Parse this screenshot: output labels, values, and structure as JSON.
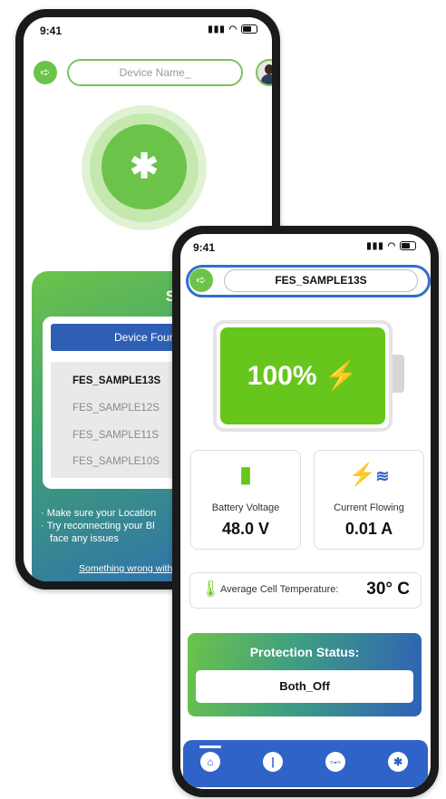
{
  "back_screen": {
    "status": {
      "time": "9:41"
    },
    "device_name_placeholder": "Device Name_",
    "scan_title": "Scan your",
    "found_header": "Device Foun",
    "devices": [
      "FES_SAMPLE13S",
      "FES_SAMPLE12S",
      "FES_SAMPLE11S",
      "FES_SAMPLE10S"
    ],
    "tips": [
      "Make sure your Location",
      "Try reconnecting your Bl",
      "face any issues"
    ],
    "help_link": "Something wrong with"
  },
  "front_screen": {
    "status": {
      "time": "9:41"
    },
    "device_name": "FES_SAMPLE13S",
    "battery": {
      "percent_label": "100%",
      "level": 1.0
    },
    "battery_voltage": {
      "label": "Battery Voltage",
      "value": "48.0 V"
    },
    "current_flowing": {
      "label": "Current Flowing",
      "value": "0.01 A"
    },
    "temperature": {
      "label": "Average Cell Temperature:",
      "value": "30° C"
    },
    "protection": {
      "title": "Protection Status:",
      "value": "Both_Off"
    },
    "nav": [
      "home-icon",
      "thermometer-icon",
      "circuit-icon",
      "bluetooth-icon"
    ]
  },
  "colors": {
    "accent_green": "#6cc34a",
    "accent_blue": "#2f6fca",
    "battery_fill": "#66c61c"
  }
}
